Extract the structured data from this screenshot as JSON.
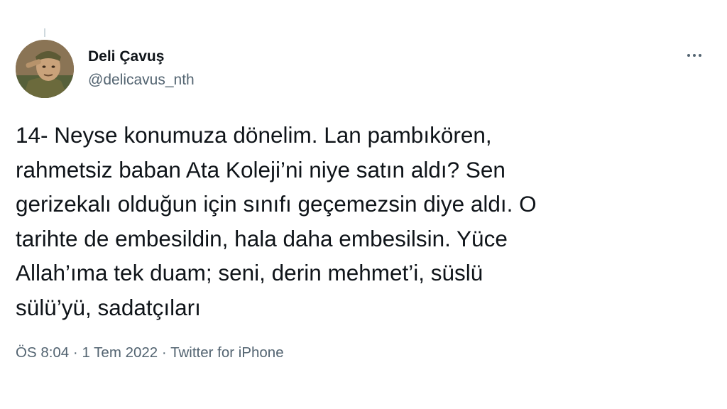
{
  "author": {
    "name": "Deli Çavuş",
    "handle": "@delicavus_nth"
  },
  "tweet": {
    "text": "14- Neyse konumuza dönelim. Lan pambıkören,\nrahmetsiz baban Ata Koleji’ni niye satın aldı? Sen\ngerizekalı olduğun için sınıfı geçemezsin diye aldı. O\ntarihte de embesildin, hala daha embesilsin. Yüce\nAllah’ıma tek duam; seni, derin mehmet’i, süslü\nsülü’yü, sadatçıları"
  },
  "meta": {
    "time": "ÖS 8:04",
    "separator": "·",
    "date": "1 Tem 2022",
    "source": "Twitter for iPhone"
  },
  "icons": {
    "more": "more-horizontal-icon",
    "avatar": "avatar"
  },
  "colors": {
    "text": "#0f1419",
    "secondary": "#536471",
    "thread_line": "#cfd9de"
  }
}
